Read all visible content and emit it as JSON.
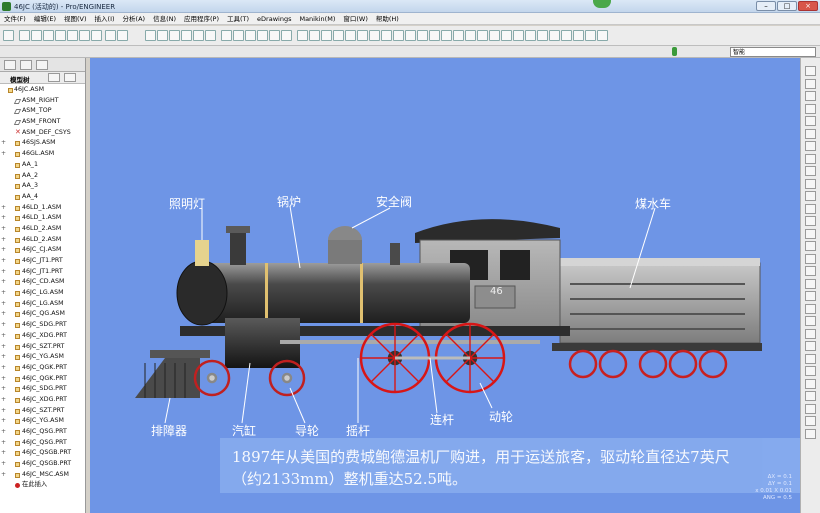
{
  "window": {
    "title": "46JC (活动的) - Pro/ENGINEER"
  },
  "menu": [
    "文件(F)",
    "编辑(E)",
    "视图(V)",
    "插入(I)",
    "分析(A)",
    "信息(N)",
    "应用程序(P)",
    "工具(T)",
    "eDrawings",
    "Manikin(M)",
    "窗口(W)",
    "帮助(H)"
  ],
  "filter": {
    "value": "智能"
  },
  "model_tree": {
    "header": "模型树",
    "items": [
      {
        "label": "46JC.ASM",
        "icon": "asm",
        "level": 0,
        "expandable": false
      },
      {
        "label": "ASM_RIGHT",
        "icon": "plane",
        "level": 1,
        "expandable": false
      },
      {
        "label": "ASM_TOP",
        "icon": "plane",
        "level": 1,
        "expandable": false
      },
      {
        "label": "ASM_FRONT",
        "icon": "plane",
        "level": 1,
        "expandable": false
      },
      {
        "label": "ASM_DEF_CSYS",
        "icon": "csys",
        "level": 1,
        "expandable": false
      },
      {
        "label": "46SJS.ASM",
        "icon": "asm",
        "level": 1,
        "expandable": true
      },
      {
        "label": "46GL.ASM",
        "icon": "asm",
        "level": 1,
        "expandable": true
      },
      {
        "label": "AA_1",
        "icon": "axis",
        "level": 1,
        "expandable": false
      },
      {
        "label": "AA_2",
        "icon": "axis",
        "level": 1,
        "expandable": false
      },
      {
        "label": "AA_3",
        "icon": "axis",
        "level": 1,
        "expandable": false
      },
      {
        "label": "AA_4",
        "icon": "axis",
        "level": 1,
        "expandable": false
      },
      {
        "label": "46LD_1.ASM",
        "icon": "asm",
        "level": 1,
        "expandable": true
      },
      {
        "label": "46LD_1.ASM",
        "icon": "asm",
        "level": 1,
        "expandable": true
      },
      {
        "label": "46LD_2.ASM",
        "icon": "asm",
        "level": 1,
        "expandable": true
      },
      {
        "label": "46LD_2.ASM",
        "icon": "asm",
        "level": 1,
        "expandable": true
      },
      {
        "label": "46JC_CJ.ASM",
        "icon": "asm",
        "level": 1,
        "expandable": true
      },
      {
        "label": "46JC_JT1.PRT",
        "icon": "prt",
        "level": 1,
        "expandable": true
      },
      {
        "label": "46JC_JT1.PRT",
        "icon": "prt",
        "level": 1,
        "expandable": true
      },
      {
        "label": "46JC_CD.ASM",
        "icon": "asm",
        "level": 1,
        "expandable": true
      },
      {
        "label": "46JC_LG.ASM",
        "icon": "asm",
        "level": 1,
        "expandable": true
      },
      {
        "label": "46JC_LG.ASM",
        "icon": "asm",
        "level": 1,
        "expandable": true
      },
      {
        "label": "46JC_QG.ASM",
        "icon": "asm",
        "level": 1,
        "expandable": true
      },
      {
        "label": "46JC_SDG.PRT",
        "icon": "prt",
        "level": 1,
        "expandable": true
      },
      {
        "label": "46JC_XDG.PRT",
        "icon": "prt",
        "level": 1,
        "expandable": true
      },
      {
        "label": "46JC_SZT.PRT",
        "icon": "prt",
        "level": 1,
        "expandable": true
      },
      {
        "label": "46JC_YG.ASM",
        "icon": "asm",
        "level": 1,
        "expandable": true
      },
      {
        "label": "46JC_QGK.PRT",
        "icon": "prt",
        "level": 1,
        "expandable": true
      },
      {
        "label": "46JC_QGK.PRT",
        "icon": "prt",
        "level": 1,
        "expandable": true
      },
      {
        "label": "46JC_SDG.PRT",
        "icon": "prt",
        "level": 1,
        "expandable": true
      },
      {
        "label": "46JC_XDG.PRT",
        "icon": "prt",
        "level": 1,
        "expandable": true
      },
      {
        "label": "46JC_SZT.PRT",
        "icon": "prt",
        "level": 1,
        "expandable": true
      },
      {
        "label": "46JC_YG.ASM",
        "icon": "asm",
        "level": 1,
        "expandable": true
      },
      {
        "label": "46JC_QSG.PRT",
        "icon": "prt",
        "level": 1,
        "expandable": true
      },
      {
        "label": "46JC_QSG.PRT",
        "icon": "prt",
        "level": 1,
        "expandable": true
      },
      {
        "label": "46JC_QSGB.PRT",
        "icon": "prt",
        "level": 1,
        "expandable": true
      },
      {
        "label": "46JC_QSGB.PRT",
        "icon": "prt",
        "level": 1,
        "expandable": true
      },
      {
        "label": "46JC_MSC.ASM",
        "icon": "asm",
        "level": 1,
        "expandable": true
      },
      {
        "label": "在此插入",
        "icon": "insert",
        "level": 1,
        "expandable": false
      }
    ]
  },
  "viewport": {
    "background": "#6e95e6",
    "callouts": {
      "headlight": "照明灯",
      "boiler": "锅炉",
      "safety_valve": "安全阀",
      "tender": "煤水车",
      "cowcatcher": "排障器",
      "cylinder": "汽缸",
      "guide_wheel": "导轮",
      "rocker": "摇杆",
      "connecting_rod": "连杆",
      "driving_wheel": "动轮"
    },
    "cab_number": "46",
    "caption_line1": "1897年从美国的费城鲍德温机厂购进，用于运送旅客，驱动轮直径达7英尺",
    "caption_line2": "（约2133mm）整机重达52.5吨。",
    "coords": [
      "ΔX = 0.1",
      "ΔY = 0.1",
      "x 0.01 X 0.01",
      "ANG = 0.5"
    ]
  },
  "colors": {
    "wheel": "#d81616",
    "body": "#3a3a3a",
    "tender": "#9a9a9a",
    "accent": "#f3d78a"
  }
}
